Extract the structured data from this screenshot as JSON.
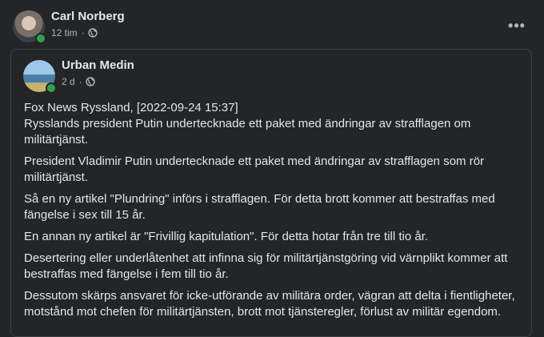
{
  "post": {
    "author": "Carl Norberg",
    "time": "12 tim",
    "separator": "·",
    "privacy_icon": "globe-icon",
    "more_icon": "more-options-icon",
    "more_label": "•••"
  },
  "shared": {
    "author": "Urban Medin",
    "time": "2 d",
    "separator": "·",
    "privacy_icon": "globe-icon",
    "paragraphs": [
      "Fox News Ryssland, [2022-09-24 15:37]\nRysslands president Putin undertecknade ett paket med ändringar av strafflagen om militärtjänst.",
      "President Vladimir Putin undertecknade ett paket med ändringar av strafflagen som rör militärtjänst.",
      "Så en ny artikel \"Plundring\" införs i strafflagen. För detta brott kommer att bestraffas med fängelse i sex till 15 år.",
      "En annan ny artikel är \"Frivillig kapitulation\". För detta hotar från tre till tio år.",
      "Desertering eller underlåtenhet att infinna sig för militärtjänstgöring vid värnplikt kommer att bestraffas med fängelse i fem till tio år.",
      "Dessutom skärps ansvaret för icke-utförande av militära order, vägran att delta i fientligheter, motstånd mot chefen för militärtjänsten, brott mot tjänsteregler, förlust av militär egendom."
    ]
  },
  "colors": {
    "background": "#242526",
    "text": "#e4e6eb",
    "secondary_text": "#b0b3b8",
    "online": "#31a24c",
    "border": "#3e4042"
  }
}
